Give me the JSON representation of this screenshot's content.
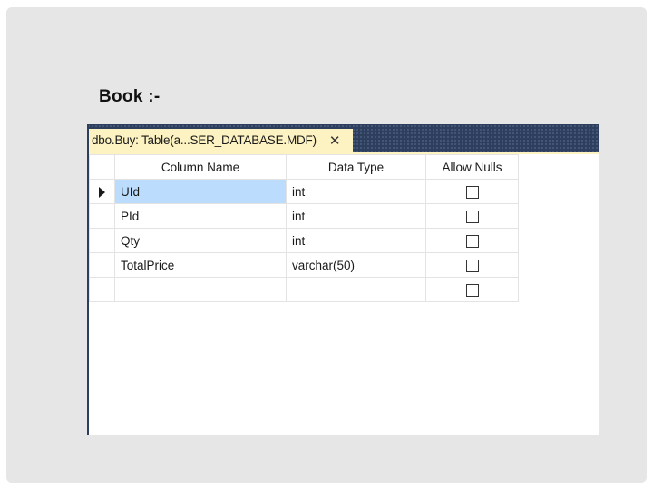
{
  "slide": {
    "title": "Book :-"
  },
  "designer": {
    "tab_label": "dbo.Buy: Table(a...SER_DATABASE.MDF)",
    "tab_close": "✕",
    "columns": {
      "name": "Column Name",
      "type": "Data Type",
      "nulls": "Allow Nulls"
    },
    "rows": [
      {
        "name": "UId",
        "type": "int",
        "allow_nulls": false,
        "current": true
      },
      {
        "name": "PId",
        "type": "int",
        "allow_nulls": false,
        "current": false
      },
      {
        "name": "Qty",
        "type": "int",
        "allow_nulls": false,
        "current": false
      },
      {
        "name": "TotalPrice",
        "type": "varchar(50)",
        "allow_nulls": false,
        "current": false
      },
      {
        "name": "",
        "type": "",
        "allow_nulls": false,
        "current": false
      }
    ]
  },
  "colors": {
    "tabstrip": "#2e3f5e",
    "active_tab": "#fdf3c2",
    "selected_cell": "#bcdcfd"
  }
}
